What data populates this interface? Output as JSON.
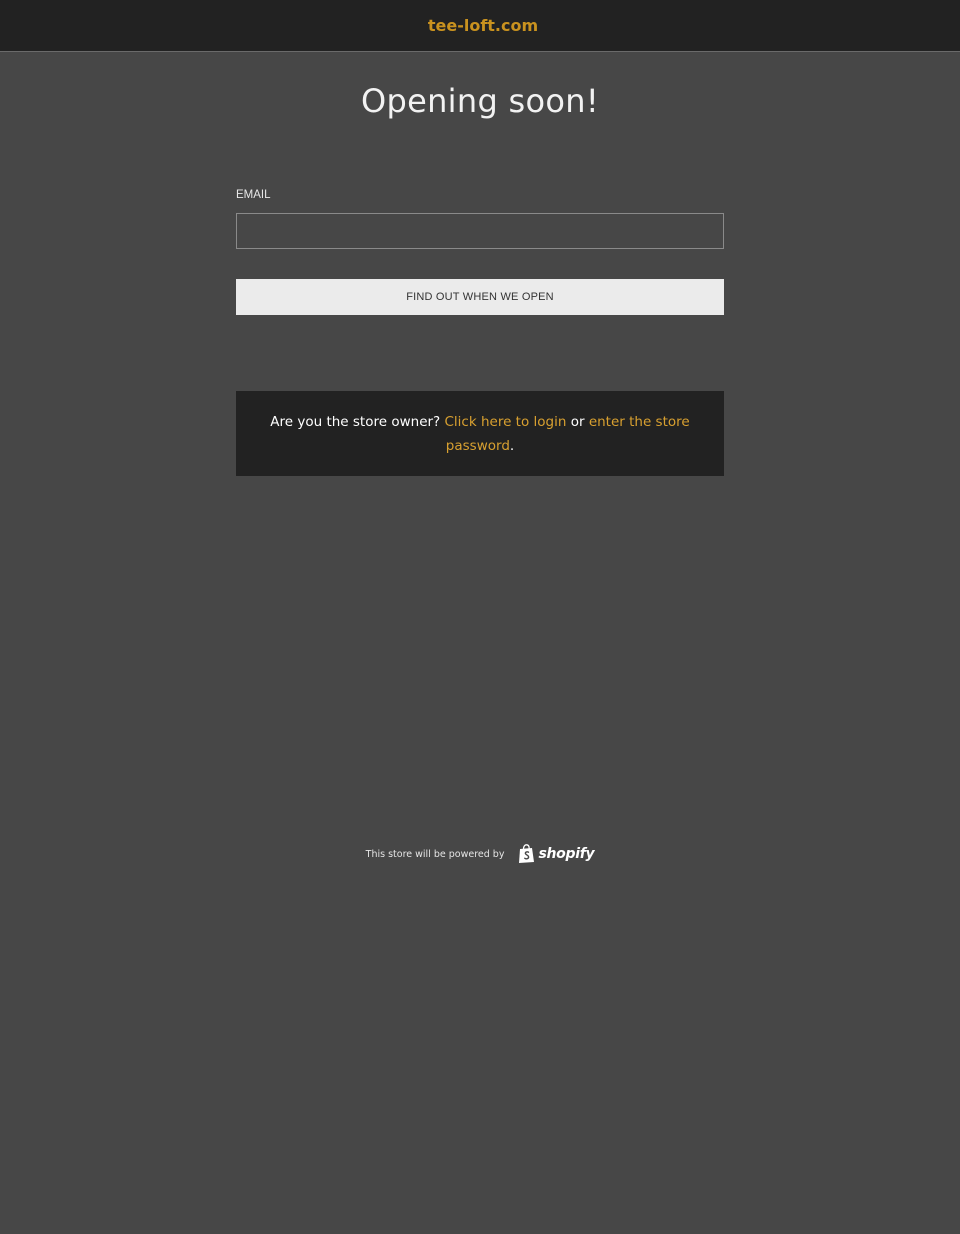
{
  "header": {
    "store_name": "tee-loft.com"
  },
  "main": {
    "headline": "Opening soon!",
    "email_label": "EMAIL",
    "email_value": "",
    "email_placeholder": "",
    "submit_label": "FIND OUT WHEN WE OPEN"
  },
  "owner_box": {
    "prefix": "Are you the store owner? ",
    "login_link": "Click here to login",
    "middle": " or ",
    "password_link": "enter the store password",
    "suffix": "."
  },
  "footer": {
    "powered_text": "This store will be powered by",
    "brand": "shopify"
  },
  "colors": {
    "background": "#474747",
    "topbar": "#222222",
    "accent": "#c9921f",
    "link": "#d8a030",
    "button": "#ebebeb"
  },
  "icons": {
    "footer_logo": "shopify-bag-icon"
  }
}
